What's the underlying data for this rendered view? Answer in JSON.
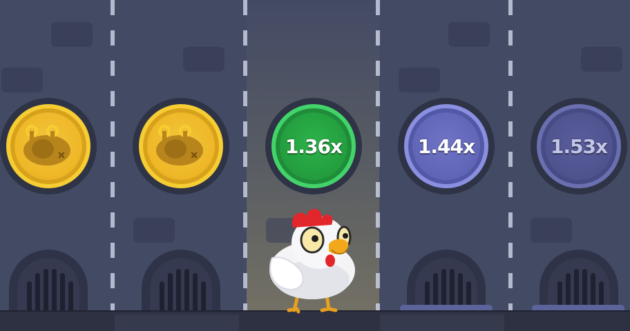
{
  "game": {
    "lanes": [
      {
        "state": "passed",
        "coin_style": "gold",
        "icon": "roast-chicken-icon",
        "multiplier": ""
      },
      {
        "state": "passed",
        "coin_style": "gold",
        "icon": "roast-chicken-icon",
        "multiplier": ""
      },
      {
        "state": "current",
        "coin_style": "green",
        "icon": "",
        "multiplier": "1.36x"
      },
      {
        "state": "next",
        "coin_style": "blue",
        "icon": "",
        "multiplier": "1.44x"
      },
      {
        "state": "upcoming",
        "coin_style": "blue-dim",
        "icon": "",
        "multiplier": "1.53x"
      }
    ],
    "player": {
      "icon": "chicken-icon",
      "lane": 3
    }
  },
  "colors": {
    "background": "#434a64",
    "gold": "#eeb728",
    "green": "#2cb34a",
    "blue": "#6f74c6",
    "blue_dim": "#595d9c",
    "floor": "#2d3142"
  }
}
